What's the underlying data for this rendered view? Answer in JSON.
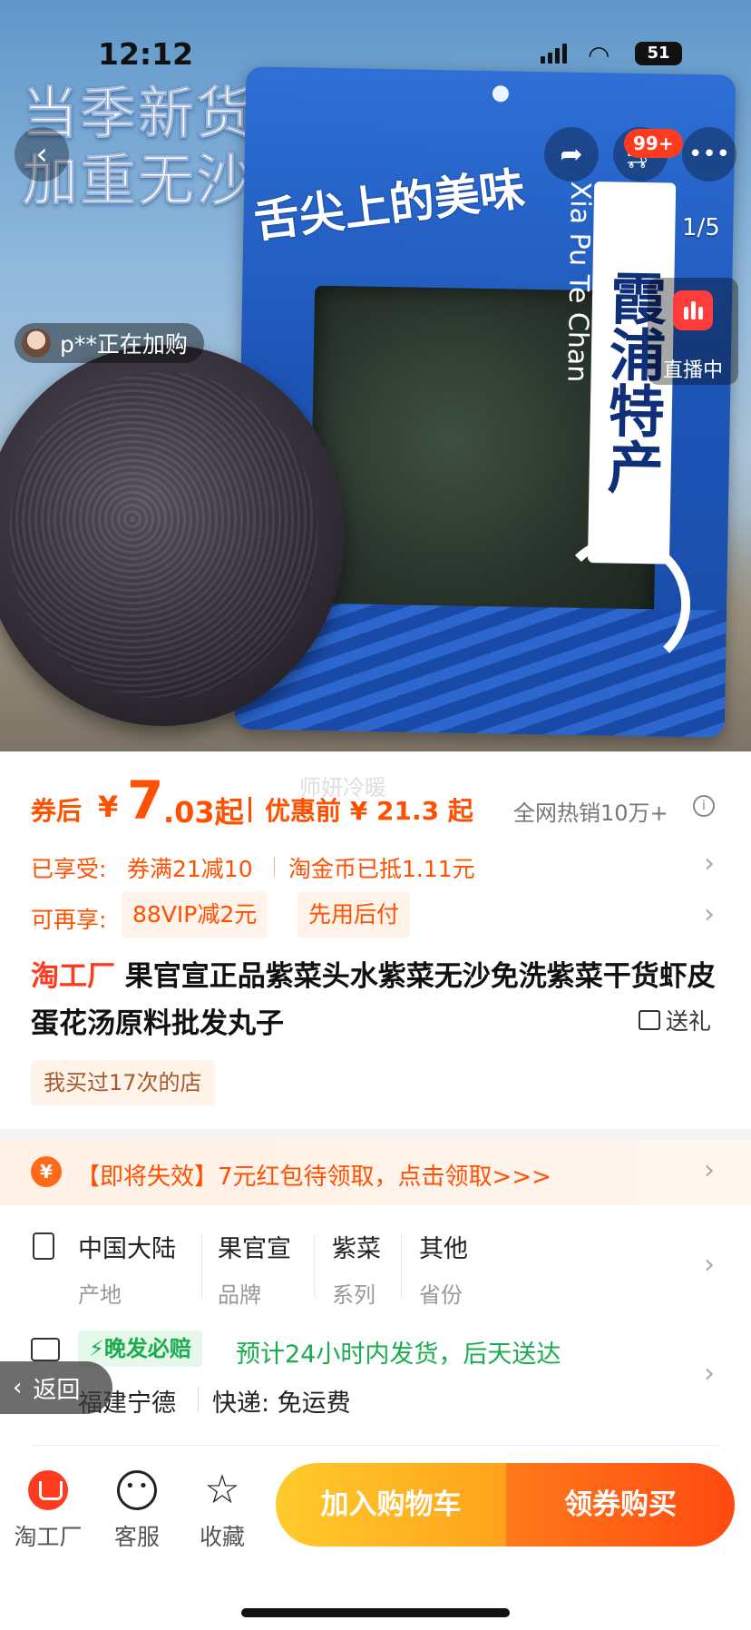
{
  "status_bar": {
    "time": "12:12",
    "battery": "51"
  },
  "hero": {
    "slogan_line1": "当季新货",
    "slogan_line2": "加重无沙",
    "bag_brand": "舌尖上的美味",
    "bag_title_cn": "霞浦特产",
    "bag_title_en": "Xia Pu Te Chan",
    "cart_badge": "99+",
    "image_counter": "1/5",
    "live_label": "直播中",
    "buyer_notice": "p**正在加购",
    "watermark": "师妍冷暖"
  },
  "price": {
    "after_coupon_label": "券后",
    "currency": "¥",
    "after_coupon_int": "7",
    "after_coupon_dec": ".03起",
    "before_label": "优惠前 ¥ 21.3 起",
    "hot_sales": "全网热销10万+",
    "info_icon": "i"
  },
  "discounts": {
    "enjoyed_label": "已享受:",
    "coupon": "券满21减10",
    "coins": "淘金币已抵1.11元",
    "more_label": "可再享:",
    "vip": "88VIP减2元",
    "pay_later": "先用后付"
  },
  "product": {
    "tag": "淘工厂",
    "title": "果官宣正品紫菜头水紫菜无沙免洗紫菜干货虾皮蛋花汤原料批发丸子",
    "gift": "送礼",
    "bought_before": "我买过17次的店"
  },
  "redpack": {
    "coin": "¥",
    "text": "【即将失效】7元红包待领取，点击领取>>>"
  },
  "attributes": [
    {
      "value": "中国大陆",
      "key": "产地"
    },
    {
      "value": "果官宣",
      "key": "品牌"
    },
    {
      "value": "紫菜",
      "key": "系列"
    },
    {
      "value": "其他",
      "key": "省份"
    }
  ],
  "shipping": {
    "badge": "晚发必赔",
    "eta": "预计24小时内发货，后天送达",
    "from": "福建宁德",
    "express": "快递: 免运费",
    "back": "返回"
  },
  "bottom_bar": {
    "tabs": [
      {
        "label": "淘工厂"
      },
      {
        "label": "客服"
      },
      {
        "label": "收藏"
      }
    ],
    "add_cart": "加入购物车",
    "buy": "领券购买"
  },
  "colors": {
    "accent": "#ff5000",
    "green": "#1aad4f",
    "cart_btn": "#ffb020",
    "buy_btn": "#ff5a12"
  }
}
